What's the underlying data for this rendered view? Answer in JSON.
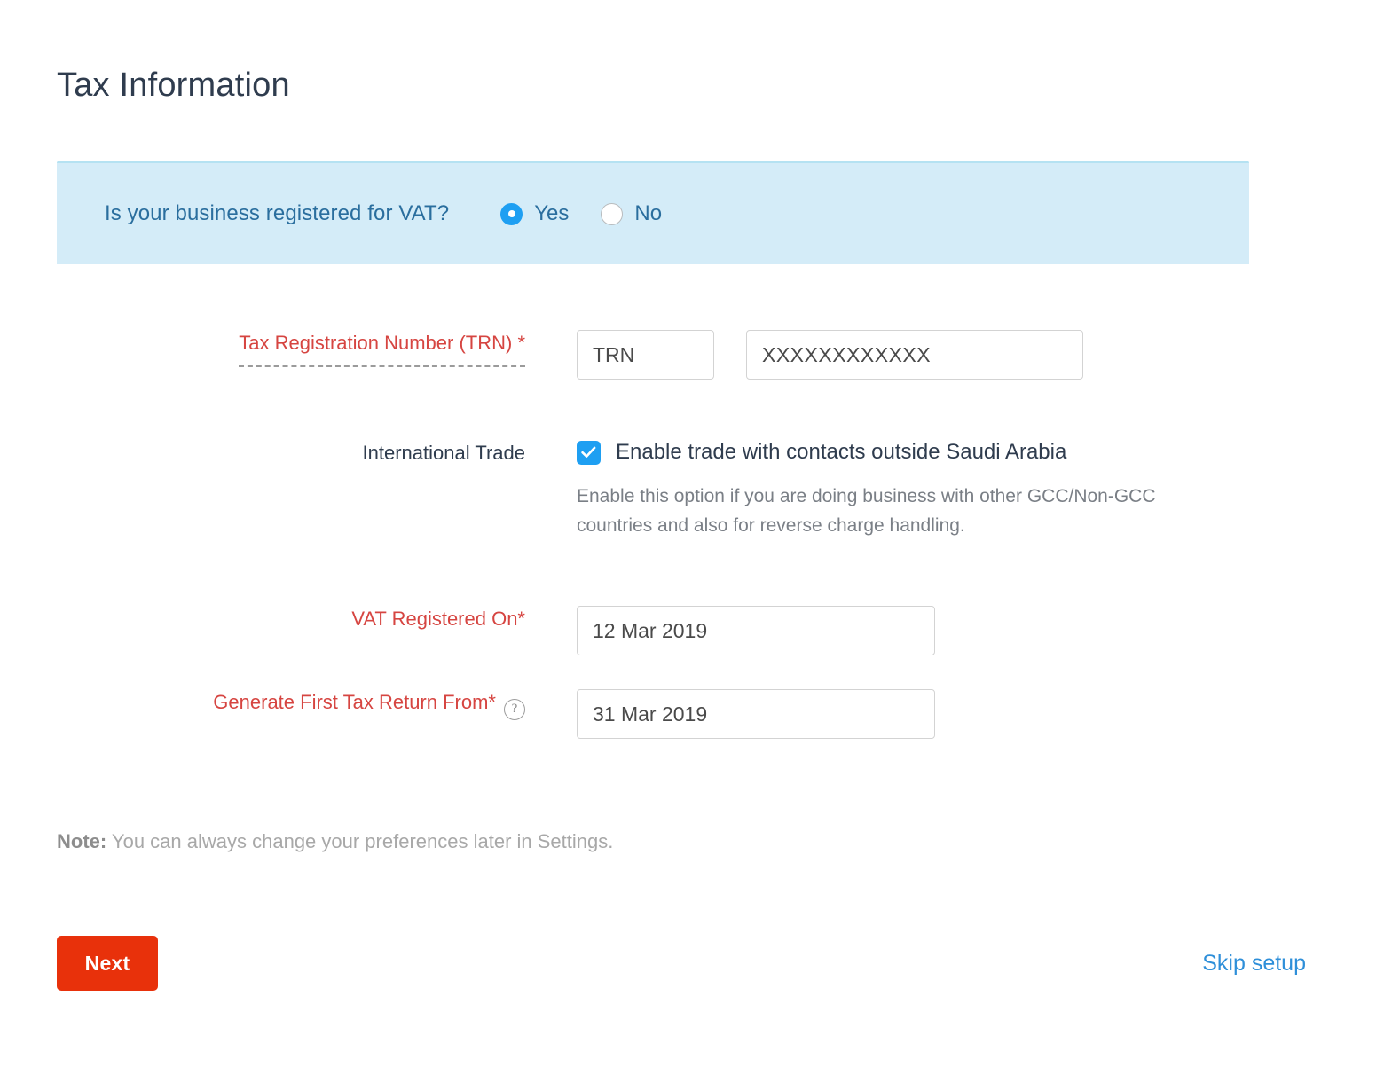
{
  "page": {
    "title": "Tax Information"
  },
  "vat_banner": {
    "question": "Is your business registered for VAT?",
    "options": [
      {
        "label": "Yes",
        "selected": true
      },
      {
        "label": "No",
        "selected": false
      }
    ],
    "background_color": "#d4ecf8",
    "text_color": "#2a6e9e",
    "accent_color": "#1e9ff2"
  },
  "form": {
    "trn": {
      "label": "Tax Registration Number (TRN) *",
      "code_value": "TRN",
      "code_placeholder": "TRN",
      "number_value": "XXXXXXXXXXXX",
      "number_placeholder": "XXXXXXXXXXXX",
      "label_color": "#d64541"
    },
    "international_trade": {
      "label": "International Trade",
      "checkbox_label": "Enable trade with contacts outside Saudi Arabia",
      "checked": true,
      "description": "Enable this option if you are doing business with other GCC/Non-GCC countries and also for reverse charge handling.",
      "checkbox_color": "#1e9ff2"
    },
    "vat_registered_on": {
      "label": "VAT Registered On*",
      "value": "12 Mar 2019",
      "placeholder": "12 Mar 2019",
      "label_color": "#d64541"
    },
    "first_tax_return": {
      "label": "Generate First Tax Return From*",
      "help_icon": "?",
      "value": "31 Mar 2019",
      "placeholder": "31 Mar 2019",
      "label_color": "#d64541"
    }
  },
  "note": {
    "prefix": "Note:",
    "text": " You can always change your preferences later in Settings."
  },
  "footer": {
    "next_label": "Next",
    "next_color": "#e8310b",
    "skip_label": "Skip setup",
    "skip_color": "#2e8fd9"
  }
}
